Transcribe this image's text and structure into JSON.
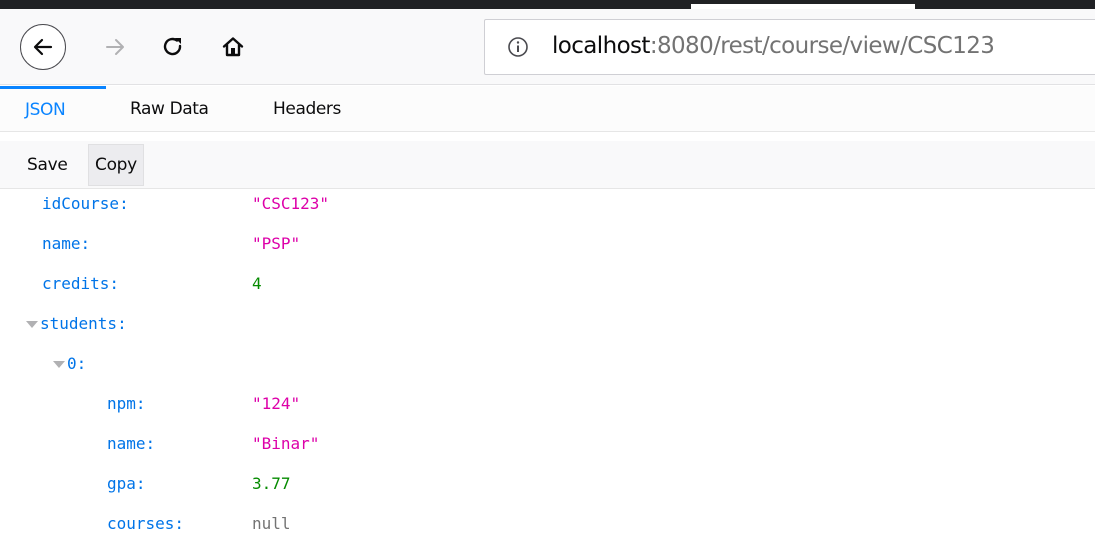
{
  "browser": {
    "url_host": "localhost",
    "url_path": ":8080/rest/course/view/CSC123"
  },
  "viewer": {
    "tabs": [
      "JSON",
      "Raw Data",
      "Headers"
    ],
    "actions": [
      "Save",
      "Copy"
    ]
  },
  "json": {
    "rows": [
      {
        "key": "idCourse:",
        "value": "\"CSC123\"",
        "type": "string"
      },
      {
        "key": "name:",
        "value": "\"PSP\"",
        "type": "string"
      },
      {
        "key": "credits:",
        "value": "4",
        "type": "number"
      },
      {
        "key": "students:",
        "value": "",
        "type": "array"
      },
      {
        "key": "0:",
        "value": "",
        "type": "object"
      },
      {
        "key": "npm:",
        "value": "\"124\"",
        "type": "string"
      },
      {
        "key": "name:",
        "value": "\"Binar\"",
        "type": "string"
      },
      {
        "key": "gpa:",
        "value": "3.77",
        "type": "number"
      },
      {
        "key": "courses:",
        "value": "null",
        "type": "null"
      }
    ]
  },
  "colors": {
    "key": "#0074e8",
    "string": "#dd00a9",
    "number": "#058b00",
    "null": "#737373",
    "active_tab": "#0a84ff"
  },
  "icons": [
    "back-arrow-icon",
    "forward-arrow-icon",
    "reload-icon",
    "home-icon",
    "info-icon",
    "expand-triangle-icon"
  ]
}
